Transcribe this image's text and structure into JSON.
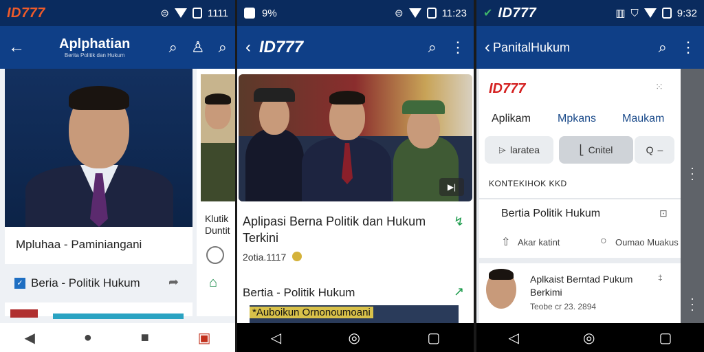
{
  "panel1": {
    "status": {
      "brand": "ID777",
      "time": "1111"
    },
    "appbar": {
      "title": "Aplphatian",
      "subtitle": "Berita Politik dan Hukum"
    },
    "caption": "Mpluhaa - Paminiangani",
    "section_label": "Beria - Politik Hukum",
    "side_preview_title": "Klutik Duntit"
  },
  "panel2": {
    "status": {
      "left": "9%",
      "time": "11:23"
    },
    "appbar": {
      "title": "ID777"
    },
    "headline": "Aplipasi Berna Politik dan Hukum Terkini",
    "meta": "2otia.1117",
    "section_label": "Bertia - Politik Hukum",
    "preview_caption": "*Auboikun Ornonoumoani"
  },
  "panel3": {
    "status": {
      "brand": "ID777",
      "time": "9:32"
    },
    "appbar": {
      "title": "PanitalHukum"
    },
    "logo": "ID777",
    "tabs": [
      "Aplikam",
      "Mpkans",
      "Maukam"
    ],
    "buttons": [
      "laratea",
      "Cnitel"
    ],
    "search_label": "Q",
    "section_caps": "KONTEKIHOK KKD",
    "card_title": "Bertia Politik Hukum",
    "actions": [
      "Akar katint",
      "Oumao Muakus"
    ],
    "news_title": "Aplkaist Berntad Pukum Berkimi",
    "news_meta": "Teobe cr 23. 2894"
  },
  "colors": {
    "statusbar": "#0a2b5e",
    "appbar": "#0f3f87",
    "brand": "#ef5b2a",
    "logo_red": "#d42121"
  }
}
